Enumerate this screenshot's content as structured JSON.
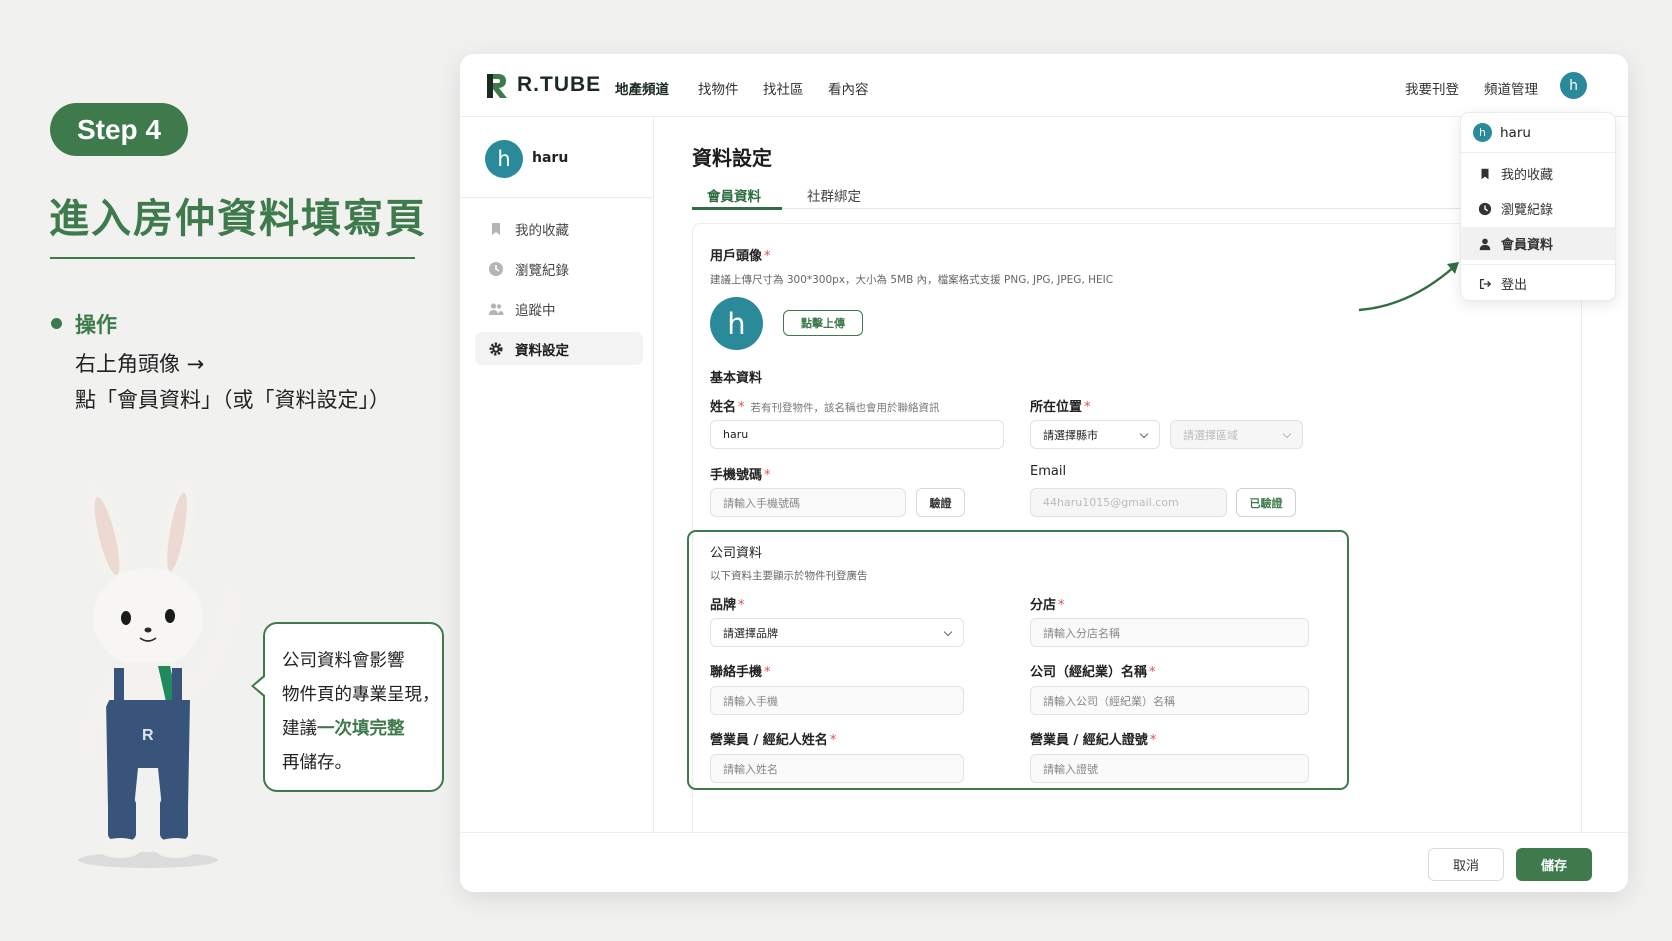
{
  "guide": {
    "step": "Step 4",
    "heading": "進入房仲資料填寫頁",
    "op_title": "操作",
    "op_line1": "右上角頭像 →",
    "op_line2": "點「會員資料」（或「資料設定」）",
    "speech_line1": "公司資料會影響",
    "speech_line2": "物件頁的專業呈現，",
    "speech_line3a": "建議",
    "speech_line3b": "一次填完整",
    "speech_line4": "再儲存。"
  },
  "topnav": {
    "brand": "R.TUBE",
    "brand_sub": "地產頻道",
    "links": [
      "找物件",
      "找社區",
      "看內容"
    ],
    "right_links": [
      "我要刊登",
      "頻道管理"
    ],
    "avatar_letter": "h"
  },
  "dropdown": {
    "user": "haru",
    "avatar_letter": "h",
    "items": [
      "我的收藏",
      "瀏覽紀錄",
      "會員資料",
      "登出"
    ]
  },
  "sidebar": {
    "user": "haru",
    "avatar_letter": "h",
    "items": [
      "我的收藏",
      "瀏覽紀錄",
      "追蹤中",
      "資料設定"
    ]
  },
  "page": {
    "title": "資料設定",
    "tabs": [
      "會員資料",
      "社群綁定"
    ]
  },
  "form": {
    "avatar_label": "用戶頭像",
    "avatar_hint": "建議上傳尺寸為 300*300px，大小為 5MB 內，檔案格式支援 PNG, JPG, JPEG, HEIC",
    "avatar_letter": "h",
    "upload_label": "點擊上傳",
    "basic_title": "基本資料",
    "name_label": "姓名",
    "name_hint": "若有刊登物件，該名稱也會用於聯絡資訊",
    "name_value": "haru",
    "location_label": "所在位置",
    "city_placeholder": "請選擇縣市",
    "district_placeholder": "請選擇區域",
    "phone_label": "手機號碼",
    "phone_placeholder": "請輸入手機號碼",
    "verify_label": "驗證",
    "email_label": "Email",
    "email_value": "44haru1015@gmail.com",
    "verified_label": "已驗證",
    "company_title": "公司資料",
    "company_hint": "以下資料主要顯示於物件刊登廣告",
    "brand_label": "品牌",
    "brand_placeholder": "請選擇品牌",
    "branch_label": "分店",
    "branch_placeholder": "請輸入分店名稱",
    "contact_label": "聯絡手機",
    "contact_placeholder": "請輸入手機",
    "company_name_label": "公司（經紀業）名稱",
    "company_name_placeholder": "請輸入公司（經紀業）名稱",
    "agent_name_label": "營業員 / 經紀人姓名",
    "agent_name_placeholder": "請輸入姓名",
    "agent_id_label": "營業員 / 經紀人證號",
    "agent_id_placeholder": "請輸入證號"
  },
  "footer": {
    "cancel": "取消",
    "save": "儲存"
  },
  "colors": {
    "brand_green": "#3e7a4c",
    "avatar_teal": "#2b8a99",
    "required_red": "#d9534f"
  }
}
